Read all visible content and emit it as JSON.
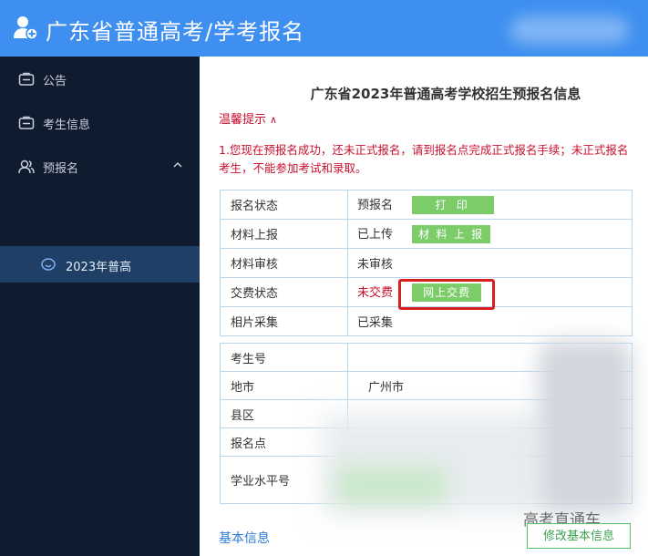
{
  "header": {
    "title": "广东省普通高考/学考报名"
  },
  "sidebar": {
    "items": [
      {
        "label": "公告",
        "icon": "notice-icon"
      },
      {
        "label": "考生信息",
        "icon": "id-card-icon"
      },
      {
        "label": "预报名",
        "icon": "user-group-icon",
        "expanded": true
      }
    ],
    "sub_items": [
      {
        "label": "2023年普高",
        "icon": "smile-icon",
        "active": true
      }
    ]
  },
  "main": {
    "title": "广东省2023年普通高考学校招生预报名信息",
    "tip_title": "温馨提示",
    "tip_body": "1.您现在预报名成功，还未正式报名，请到报名点完成正式报名手续；未正式报名考生，不能参加考试和录取。",
    "status_rows": [
      {
        "key": "报名状态",
        "value": "预报名",
        "button": "打 印"
      },
      {
        "key": "材料上报",
        "value": "已上传",
        "button": "材 料 上 报"
      },
      {
        "key": "材料审核",
        "value": "未审核"
      },
      {
        "key": "交费状态",
        "value": "未交费",
        "button": "网上交费"
      },
      {
        "key": "相片采集",
        "value": "已采集"
      }
    ],
    "info_rows": [
      {
        "key": "考生号",
        "value": ""
      },
      {
        "key": "地市",
        "value": "广州市"
      },
      {
        "key": "县区",
        "value": ""
      },
      {
        "key": "报名点",
        "value": ""
      },
      {
        "key": "学业水平号",
        "value": ""
      }
    ],
    "basic_info_link": "基本信息",
    "edit_button": "修改基本信息",
    "corner_text": "高考直通车"
  },
  "colors": {
    "topbar": "#3e8ff0",
    "sidebar": "#0f1b2e",
    "active": "#1f3f66",
    "alert": "#c8102e",
    "button": "#7ccd6a"
  }
}
